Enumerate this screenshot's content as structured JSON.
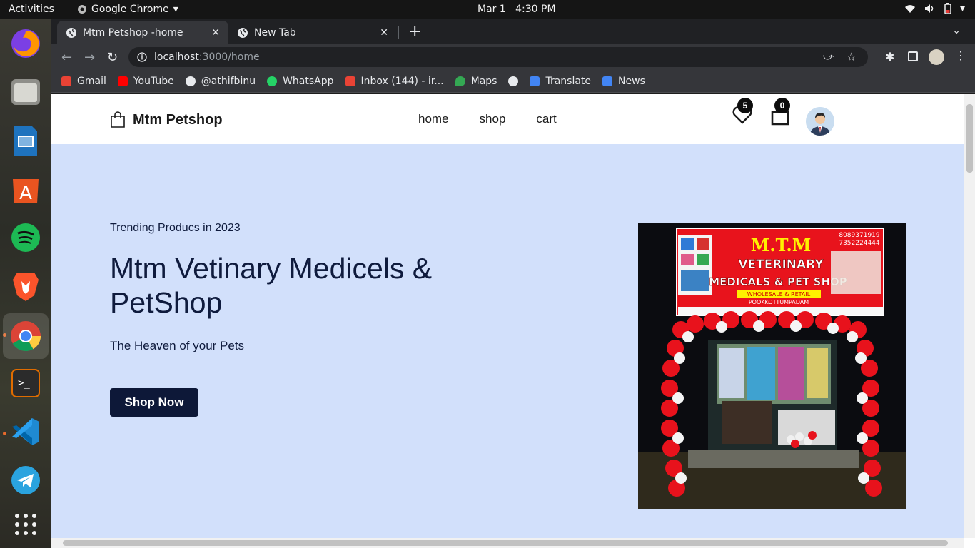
{
  "system": {
    "activities": "Activities",
    "app_name": "Google Chrome",
    "date": "Mar 1",
    "time": "4:30 PM"
  },
  "dock": {
    "apps": [
      "firefox",
      "files",
      "libreoffice-impress",
      "app-center",
      "spotify",
      "brave",
      "google-chrome",
      "terminal",
      "vscode",
      "telegram",
      "show-applications"
    ]
  },
  "browser": {
    "tabs": [
      {
        "title": "Mtm Petshop -home",
        "active": true
      },
      {
        "title": "New Tab",
        "active": false
      }
    ],
    "url_host": "localhost",
    "url_path": ":3000/home",
    "bookmarks": [
      {
        "label": "Gmail",
        "color": "#ea4335"
      },
      {
        "label": "YouTube",
        "color": "#ff0000"
      },
      {
        "label": "@athifbinu",
        "color": "#e8eaed"
      },
      {
        "label": "WhatsApp",
        "color": "#25d366"
      },
      {
        "label": "Inbox (144) - ir...",
        "color": "#ea4335"
      },
      {
        "label": "Maps",
        "color": "#34a853"
      },
      {
        "label": "",
        "color": "#e8eaed"
      },
      {
        "label": "Translate",
        "color": "#4285f4"
      },
      {
        "label": "News",
        "color": "#4285f4"
      }
    ]
  },
  "site": {
    "brand": "Mtm Petshop",
    "nav": [
      "home",
      "shop",
      "cart"
    ],
    "wishlist_count": "5",
    "cart_count": "0",
    "hero": {
      "kicker": "Trending Producs in 2023",
      "title": "Mtm Vetinary Medicels & PetShop",
      "tagline": "The Heaven of your Pets",
      "cta": "Shop Now"
    },
    "photo_sign": {
      "line1": "M.T.M",
      "line2": "VETERINARY",
      "line3": "MEDICALS & PET SHOP",
      "line4": "WHOLESALE & RETAIL",
      "line5": "POOKKOTTUMPADAM",
      "phone1": "8089371919",
      "phone2": "7352224444"
    }
  },
  "colors": {
    "hero_bg": "#d2e0fb",
    "cta_bg": "#0d1838",
    "text_dark": "#0f1b3d"
  }
}
